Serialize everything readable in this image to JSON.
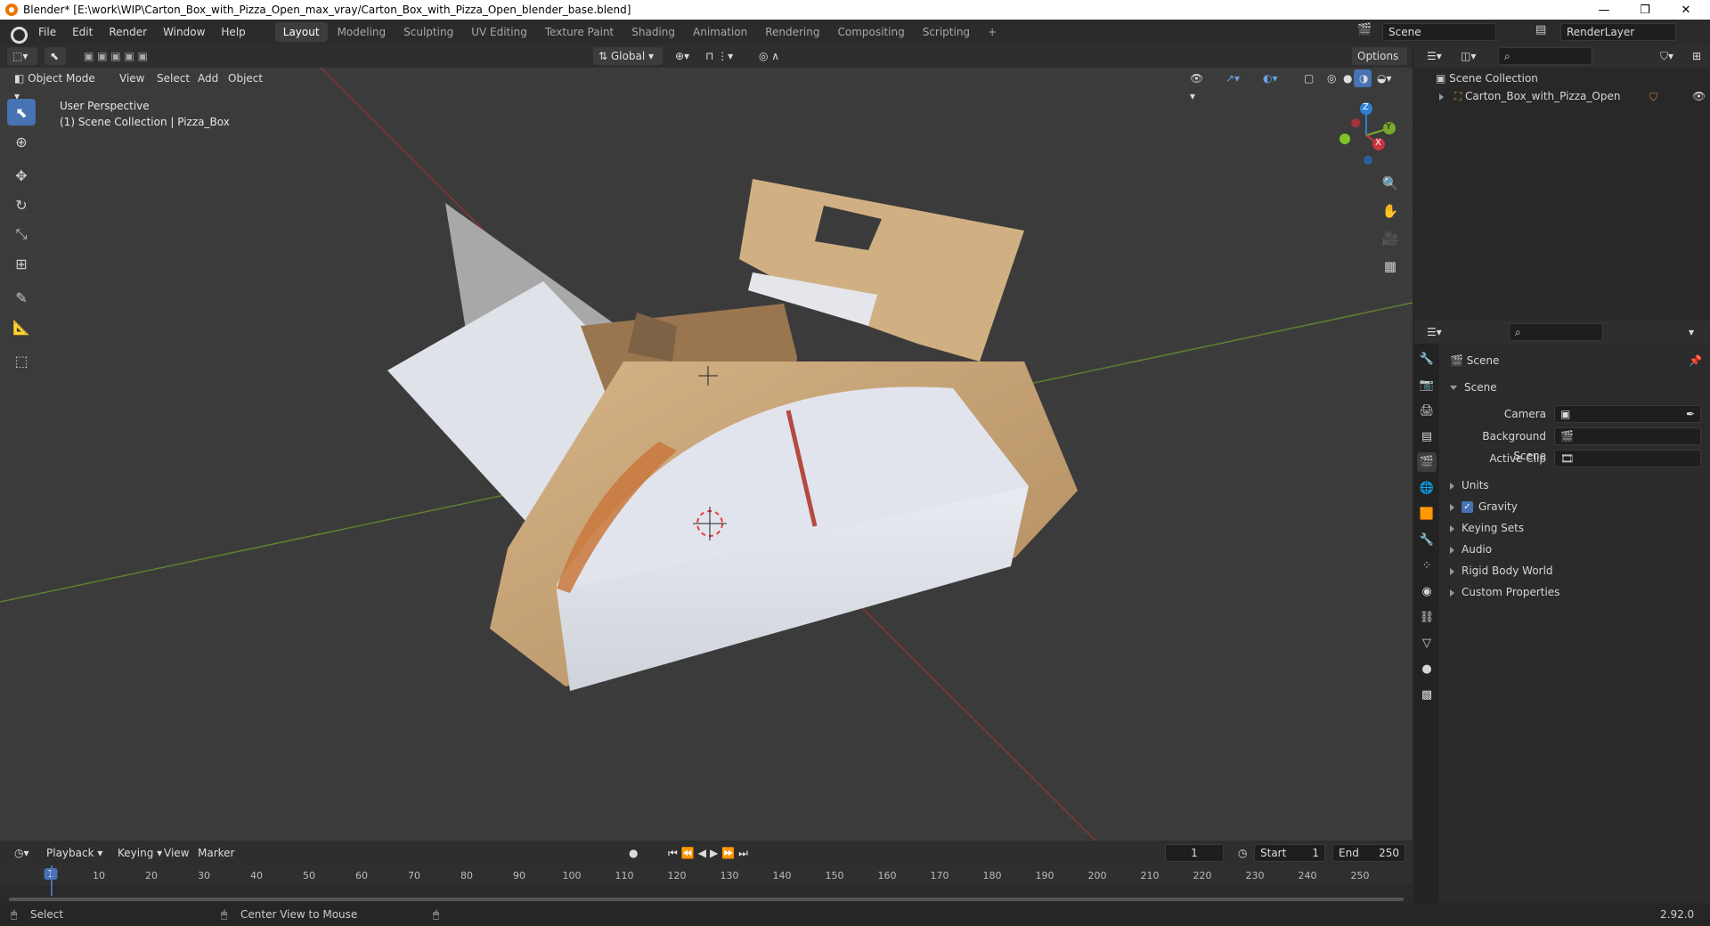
{
  "title_bar": {
    "title": "Blender* [E:\\work\\WIP\\Carton_Box_with_Pizza_Open_max_vray/Carton_Box_with_Pizza_Open_blender_base.blend]",
    "minimize": "—",
    "maximize": "❐",
    "close": "✕"
  },
  "menu": [
    "File",
    "Edit",
    "Render",
    "Window",
    "Help"
  ],
  "workspaces": [
    "Layout",
    "Modeling",
    "Sculpting",
    "UV Editing",
    "Texture Paint",
    "Shading",
    "Animation",
    "Rendering",
    "Compositing",
    "Scripting"
  ],
  "active_workspace": "Layout",
  "add_workspace": "+",
  "scene_field": "Scene",
  "render_layer_field": "RenderLayer",
  "viewport_header": {
    "transform_orientation": "Global",
    "options": "Options",
    "mode": "Object Mode",
    "menus": [
      "View",
      "Select",
      "Add",
      "Object"
    ]
  },
  "viewport": {
    "view_name": "User Perspective",
    "collection_info": "(1) Scene Collection | Pizza_Box"
  },
  "gizmo": {
    "x": "X",
    "y": "Y",
    "z": "Z"
  },
  "tools": [
    "select-box-icon",
    "cursor-icon",
    "move-icon",
    "rotate-icon",
    "scale-icon",
    "transform-icon",
    "annotate-icon",
    "measure-icon",
    "add-cube-icon"
  ],
  "outliner": {
    "root": "Scene Collection",
    "items": [
      {
        "name": "Carton_Box_with_Pizza_Open"
      }
    ]
  },
  "properties": {
    "header": "Scene",
    "section": "Scene",
    "fields": [
      {
        "label": "Camera",
        "value": ""
      },
      {
        "label": "Background Scene",
        "value": ""
      },
      {
        "label": "Active Clip",
        "value": ""
      }
    ],
    "panels": [
      "Units",
      "Gravity",
      "Keying Sets",
      "Audio",
      "Rigid Body World",
      "Custom Properties"
    ],
    "gravity_checked": true
  },
  "timeline": {
    "menus": [
      "Playback",
      "Keying",
      "View",
      "Marker"
    ],
    "current_frame": "1",
    "start_label": "Start",
    "start": "1",
    "end_label": "End",
    "end": "250",
    "ticks": [
      "1",
      "10",
      "20",
      "30",
      "40",
      "50",
      "60",
      "70",
      "80",
      "90",
      "100",
      "110",
      "120",
      "130",
      "140",
      "150",
      "160",
      "170",
      "180",
      "190",
      "200",
      "210",
      "220",
      "230",
      "240",
      "250"
    ]
  },
  "status": {
    "select": "Select",
    "center_view": "Center View to Mouse",
    "version": "2.92.0"
  },
  "colors": {
    "accent": "#4772b3",
    "x_axis": "#c8343f",
    "y_axis": "#7aa82c",
    "z_axis": "#2f7fd6",
    "cardboard": "#c9a77c",
    "box_white": "#e4e7ee"
  }
}
